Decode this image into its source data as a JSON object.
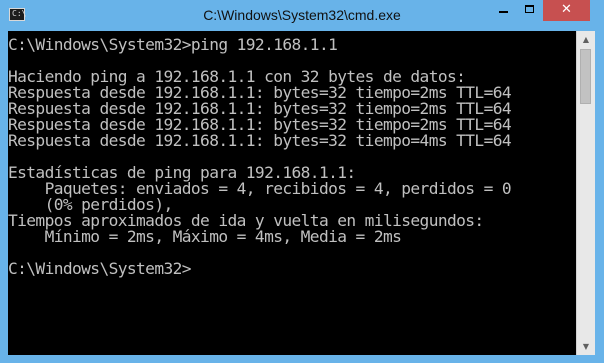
{
  "window": {
    "title": "C:\\Windows\\System32\\cmd.exe",
    "icon": "cmd-icon",
    "icon_glyph": "C:\\",
    "buttons": {
      "minimize_icon": "minimize-icon",
      "maximize_icon": "maximize-icon",
      "close_icon": "close-icon",
      "close_glyph": "✕"
    },
    "colors": {
      "frame": "#68b3e9",
      "close": "#c75050",
      "console_bg": "#000000",
      "console_fg": "#c0c0c0"
    }
  },
  "console": {
    "lines": [
      "C:\\Windows\\System32>ping 192.168.1.1",
      "",
      "Haciendo ping a 192.168.1.1 con 32 bytes de datos:",
      "Respuesta desde 192.168.1.1: bytes=32 tiempo=2ms TTL=64",
      "Respuesta desde 192.168.1.1: bytes=32 tiempo=2ms TTL=64",
      "Respuesta desde 192.168.1.1: bytes=32 tiempo=2ms TTL=64",
      "Respuesta desde 192.168.1.1: bytes=32 tiempo=4ms TTL=64",
      "",
      "Estadísticas de ping para 192.168.1.1:",
      "    Paquetes: enviados = 4, recibidos = 4, perdidos = 0",
      "    (0% perdidos),",
      "Tiempos aproximados de ida y vuelta en milisegundos:",
      "    Mínimo = 2ms, Máximo = 4ms, Media = 2ms",
      "",
      "C:\\Windows\\System32>"
    ]
  },
  "scrollbar": {
    "up_glyph": "▲",
    "down_glyph": "▼"
  }
}
